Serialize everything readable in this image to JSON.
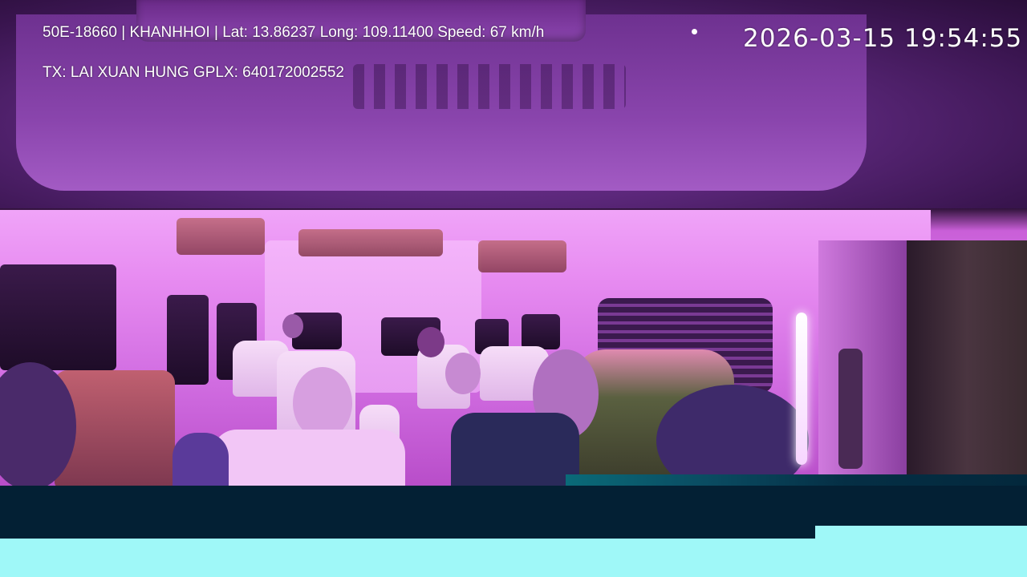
{
  "overlay": {
    "line1": "50E-18660 | KHANHHOI | Lat: 13.86237 Long: 109.11400 Speed: 67 km/h",
    "line2": "TX: LAI XUAN HUNG GPLX: 640172002552",
    "timestamp": "2026-03-15 19:54:55"
  },
  "colors": {
    "cabin_tint": "#d87ae6",
    "bottom_dark_bar": "#032034",
    "bottom_light_bar": "#9ff8f8",
    "osd_text": "#ffffff"
  }
}
